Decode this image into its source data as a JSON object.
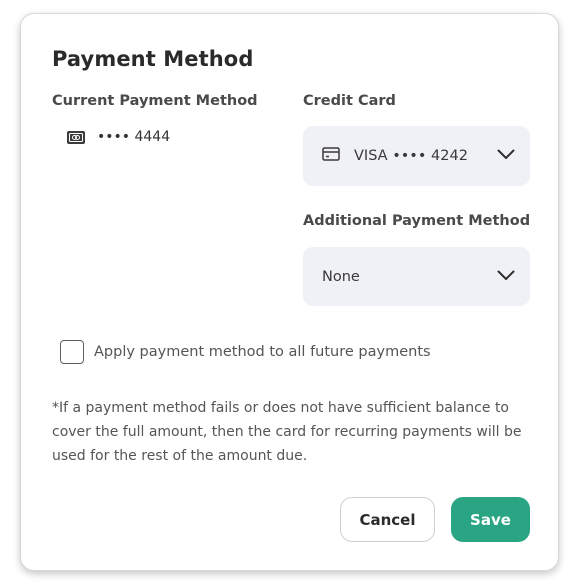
{
  "modal": {
    "title": "Payment Method",
    "current": {
      "label": "Current Payment Method",
      "icon": "credit-card-icon",
      "value": "•••• 4444"
    },
    "credit_card": {
      "label": "Credit Card",
      "icon": "card-icon",
      "selected": "VISA •••• 4242"
    },
    "additional": {
      "label": "Additional Payment Method",
      "selected": "None"
    },
    "apply_future": {
      "label": "Apply payment method to all future payments",
      "checked": false
    },
    "note": "*If a payment method fails or does not have sufficient balance to cover the full amount, then the card for recurring payments will be used for the rest of the amount due.",
    "buttons": {
      "cancel": "Cancel",
      "save": "Save"
    },
    "colors": {
      "primary": "#2aa584",
      "select_bg": "#f0f1f6"
    }
  }
}
